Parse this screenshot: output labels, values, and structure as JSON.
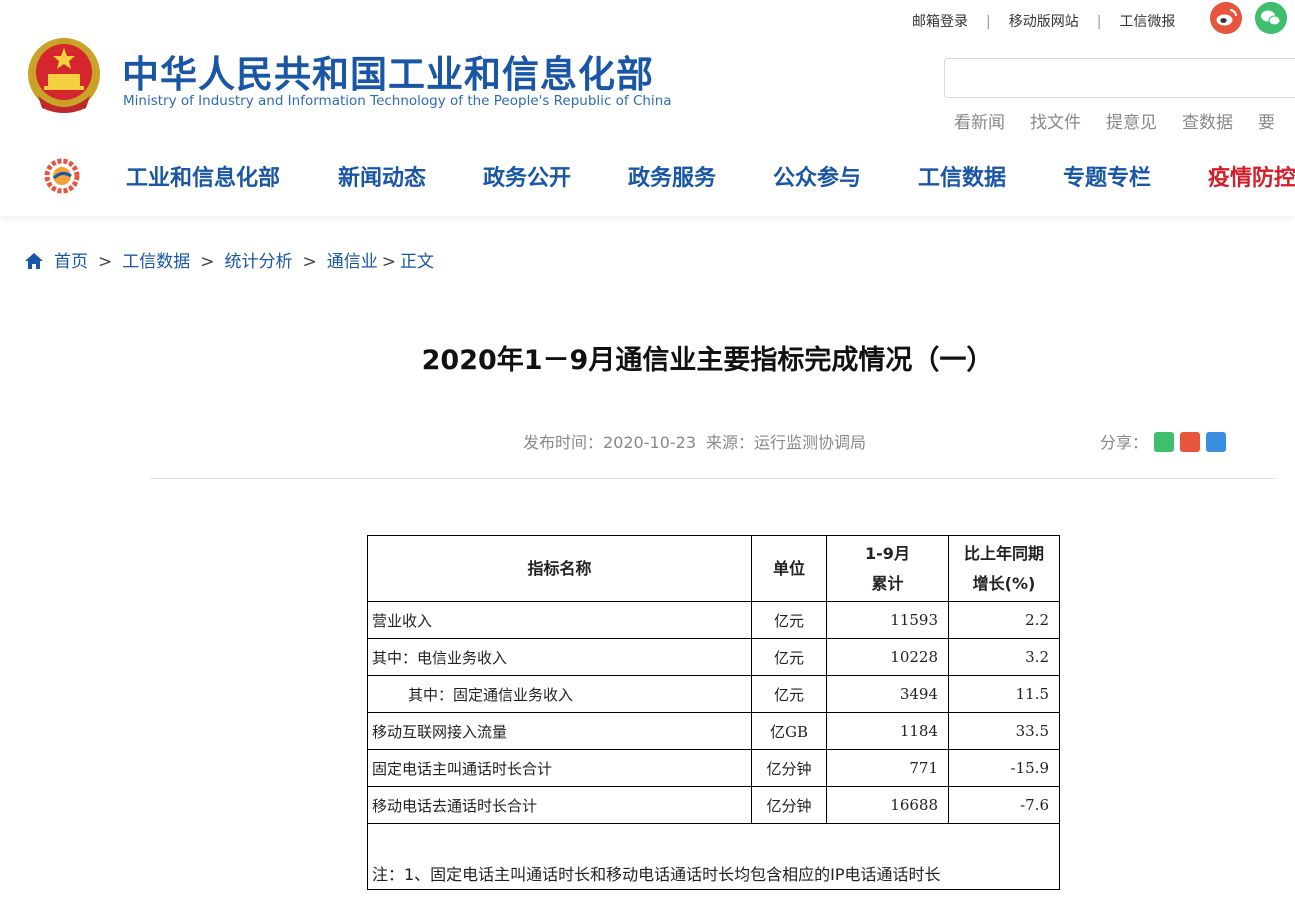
{
  "header": {
    "title": "中华人民共和国工业和信息化部",
    "subtitle": "Ministry of Industry and Information Technology of the People's Republic of China",
    "top_links": [
      "邮箱登录",
      "移动版网站",
      "工信微报"
    ],
    "top_link_separator": "|",
    "search": {
      "placeholder": ""
    },
    "quick_links": [
      "看新闻",
      "找文件",
      "提意见",
      "查数据",
      "要"
    ],
    "icons": {
      "weibo": "weibo-icon",
      "wechat": "wechat-icon"
    },
    "colors": {
      "brand": "#1a56a6",
      "alert": "#d21f2a"
    }
  },
  "nav": {
    "items": [
      "工业和信息化部",
      "新闻动态",
      "政务公开",
      "政务服务",
      "公众参与",
      "工信数据",
      "专题专栏",
      "疫情防控"
    ]
  },
  "breadcrumb": {
    "items": [
      "首页",
      "工信数据",
      "统计分析",
      "通信业",
      "正文"
    ],
    "separator": ">"
  },
  "article": {
    "title": "2020年1－9月通信业主要指标完成情况（一）",
    "publish_label": "发布时间：",
    "publish_date": "2020-10-23",
    "source_label": "来源：",
    "source": "运行监测协调局",
    "share_label": "分享："
  },
  "table": {
    "headers": {
      "name": "指标名称",
      "unit": "单位",
      "cumulative_line1": "1-9月",
      "cumulative_line2": "累计",
      "growth_line1": "比上年同期",
      "growth_line2": "增长(%)"
    },
    "rows": [
      {
        "name": "营业收入",
        "unit": "亿元",
        "value": "11593",
        "growth": "2.2"
      },
      {
        "name": "其中：电信业务收入",
        "unit": "亿元",
        "value": "10228",
        "growth": "3.2"
      },
      {
        "name": "其中：固定通信业务收入",
        "unit": "亿元",
        "value": "3494",
        "growth": "11.5"
      },
      {
        "name": "移动互联网接入流量",
        "unit": "亿GB",
        "value": "1184",
        "growth": "33.5"
      },
      {
        "name": "固定电话主叫通话时长合计",
        "unit": "亿分钟",
        "value": "771",
        "growth": "-15.9"
      },
      {
        "name": "移动电话去通话时长合计",
        "unit": "亿分钟",
        "value": "16688",
        "growth": "-7.6"
      }
    ],
    "note": "注：1、固定电话主叫通话时长和移动电话通话时长均包含相应的IP电话通话时长"
  }
}
